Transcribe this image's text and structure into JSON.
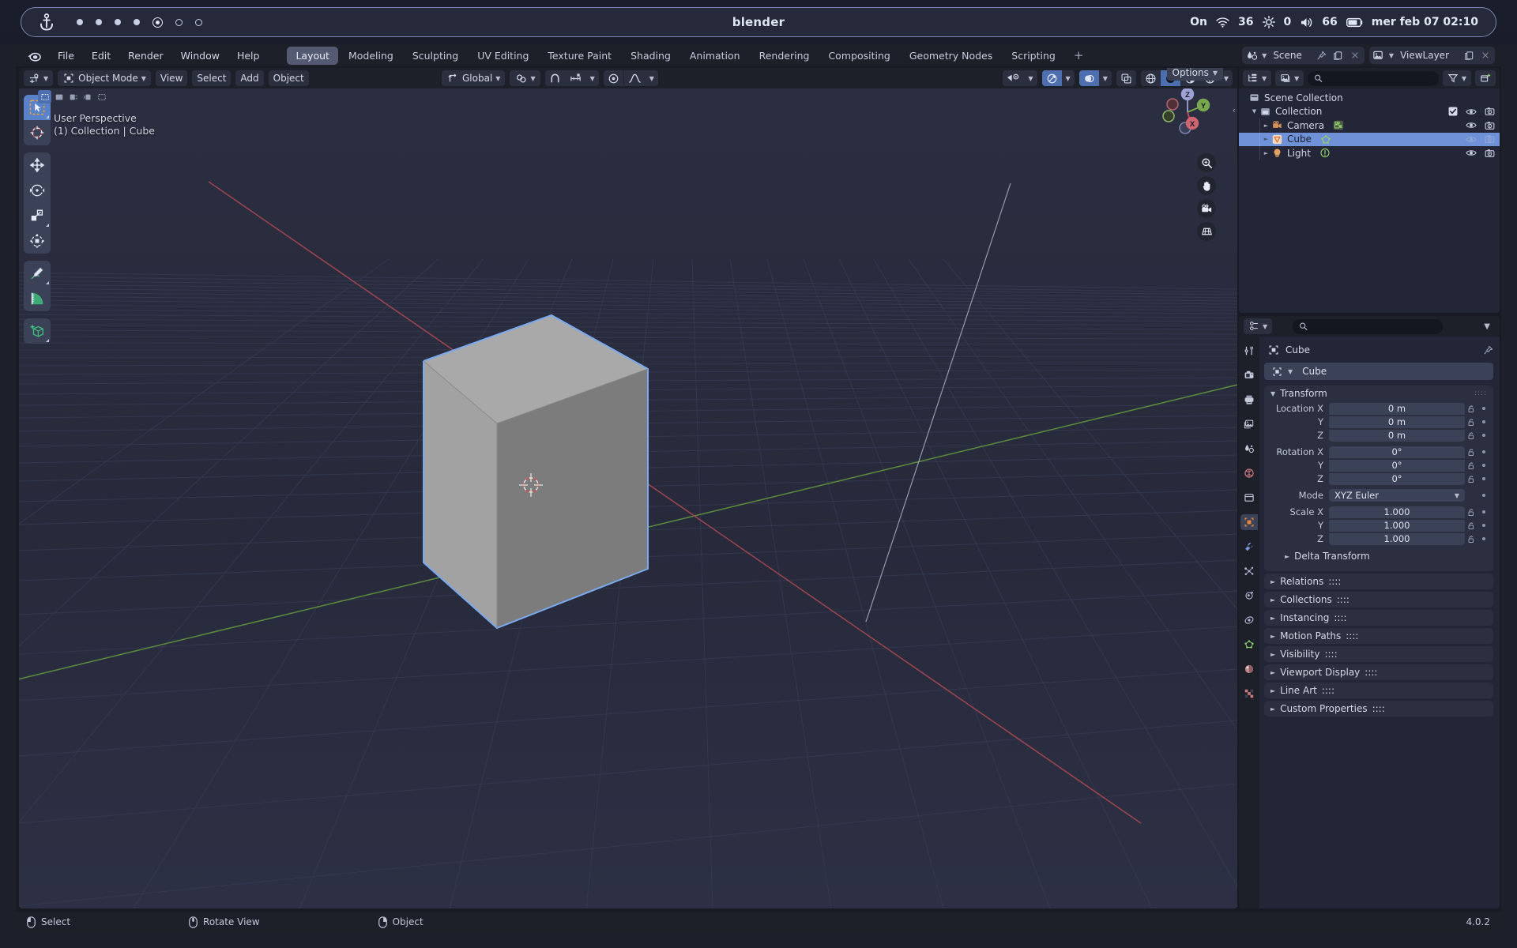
{
  "os_bar": {
    "title": "blender",
    "anchor_icon": "anchor-icon",
    "status": {
      "network_label": "On",
      "wifi_icon": "wifi-icon",
      "brightness_value": "36",
      "brightness_icon": "brightness-icon",
      "volume_value": "0",
      "volume_icon": "volume-icon",
      "battery_value": "66",
      "battery_icon": "battery-icon",
      "datetime": "mer feb 07 02:10"
    }
  },
  "topbar": {
    "logo_icon": "blender-logo-icon",
    "menus": [
      "File",
      "Edit",
      "Render",
      "Window",
      "Help"
    ],
    "workspaces": [
      {
        "label": "Layout",
        "active": true
      },
      {
        "label": "Modeling",
        "active": false
      },
      {
        "label": "Sculpting",
        "active": false
      },
      {
        "label": "UV Editing",
        "active": false
      },
      {
        "label": "Texture Paint",
        "active": false
      },
      {
        "label": "Shading",
        "active": false
      },
      {
        "label": "Animation",
        "active": false
      },
      {
        "label": "Rendering",
        "active": false
      },
      {
        "label": "Compositing",
        "active": false
      },
      {
        "label": "Geometry Nodes",
        "active": false
      },
      {
        "label": "Scripting",
        "active": false
      }
    ],
    "add_workspace_label": "+",
    "scene_name": "Scene",
    "viewlayer_name": "ViewLayer"
  },
  "viewport": {
    "header": {
      "editor_type_icon": "editor-type-3dviewport-icon",
      "mode_label": "Object Mode",
      "mode_icon": "object-mode-icon",
      "menus": [
        "View",
        "Select",
        "Add",
        "Object"
      ],
      "transform_orientation": "Global",
      "snap_icon": "magnet-icon",
      "proportional_icon": "proportional-editing-icon",
      "falloff_icon": "falloff-curve-icon",
      "pivot_icon": "pivot-point-icon"
    },
    "select_modes": [
      "tweak",
      "box-select",
      "circle-select",
      "lasso-select",
      "select-all"
    ],
    "overlay_text_line1": "User Perspective",
    "overlay_text_line2": "(1) Collection | Cube",
    "options_label": "Options",
    "gizmo_axes": [
      "Z",
      "Y",
      "X"
    ],
    "tools": [
      {
        "name": "tweak-tool",
        "active": true
      },
      {
        "name": "cursor-tool",
        "active": false
      },
      {
        "name": "move-tool",
        "active": false
      },
      {
        "name": "rotate-tool",
        "active": false
      },
      {
        "name": "scale-tool",
        "active": false
      },
      {
        "name": "transform-tool",
        "active": false
      },
      {
        "name": "annotate-tool",
        "active": false
      },
      {
        "name": "measure-tool",
        "active": false
      },
      {
        "name": "add-cube-tool",
        "active": false
      }
    ],
    "nav_controls": [
      "zoom-icon",
      "pan-hand-icon",
      "camera-view-icon",
      "ortho-persp-icon"
    ],
    "shading_modes": [
      "wireframe",
      "solid",
      "material-preview",
      "rendered"
    ],
    "active_shading": "solid"
  },
  "outliner": {
    "display_mode_icon": "outliner-display-mode-icon",
    "filter_id_icon": "outliner-id-type-icon",
    "search_placeholder": "",
    "search_value": "",
    "filter_icon": "filter-funnel-icon",
    "new_collection_icon": "new-collection-icon",
    "rows": [
      {
        "label": "Scene Collection",
        "icon": "scene-collection-icon",
        "depth": 0,
        "expandable": false,
        "selected": false,
        "checkbox": false,
        "eye": false,
        "camera": false
      },
      {
        "label": "Collection",
        "icon": "collection-icon",
        "depth": 1,
        "expandable": true,
        "expanded": true,
        "selected": false,
        "checkbox": true,
        "eye": true,
        "camera": true
      },
      {
        "label": "Camera",
        "icon": "camera-object-icon",
        "data_icon": "camera-data-icon",
        "depth": 2,
        "expandable": true,
        "expanded": false,
        "selected": false,
        "checkbox": false,
        "eye": true,
        "camera": true
      },
      {
        "label": "Cube",
        "icon": "mesh-object-icon",
        "data_icon": "mesh-data-icon",
        "depth": 2,
        "expandable": true,
        "expanded": false,
        "selected": true,
        "checkbox": false,
        "eye": true,
        "camera": true
      },
      {
        "label": "Light",
        "icon": "light-object-icon",
        "data_icon": "light-data-icon",
        "depth": 2,
        "expandable": true,
        "expanded": false,
        "selected": false,
        "checkbox": false,
        "eye": true,
        "camera": true
      }
    ]
  },
  "properties": {
    "editor_icon": "properties-editor-icon",
    "search_placeholder": "",
    "search_value": "",
    "breadcrumb_object": "Cube",
    "breadcrumb_icon": "object-properties-icon",
    "pin_icon": "pin-icon",
    "object_name_field": "Cube",
    "tabs": [
      {
        "name": "tool-tab",
        "active": false
      },
      {
        "name": "render-tab",
        "active": false
      },
      {
        "name": "output-tab",
        "active": false
      },
      {
        "name": "view-layer-tab",
        "active": false
      },
      {
        "name": "scene-tab",
        "active": false
      },
      {
        "name": "world-tab",
        "active": false
      },
      {
        "name": "collection-tab",
        "active": false
      },
      {
        "name": "object-tab",
        "active": true
      },
      {
        "name": "modifiers-tab",
        "active": false
      },
      {
        "name": "particles-tab",
        "active": false
      },
      {
        "name": "physics-tab",
        "active": false
      },
      {
        "name": "constraints-tab",
        "active": false
      },
      {
        "name": "object-data-tab",
        "active": false
      },
      {
        "name": "material-tab",
        "active": false
      },
      {
        "name": "texture-tab",
        "active": false
      }
    ],
    "transform_panel": {
      "title": "Transform",
      "location_label": "Location X",
      "rotation_label": "Rotation X",
      "scale_label": "Scale X",
      "axis_y": "Y",
      "axis_z": "Z",
      "location": [
        "0 m",
        "0 m",
        "0 m"
      ],
      "rotation": [
        "0°",
        "0°",
        "0°"
      ],
      "mode_label": "Mode",
      "mode_value": "XYZ Euler",
      "scale": [
        "1.000",
        "1.000",
        "1.000"
      ]
    },
    "subpanel_delta": "Delta Transform",
    "panels": [
      "Relations",
      "Collections",
      "Instancing",
      "Motion Paths",
      "Visibility",
      "Viewport Display",
      "Line Art",
      "Custom Properties"
    ]
  },
  "statusbar": {
    "items": [
      {
        "label": "Select",
        "icon": "mouse-left-icon"
      },
      {
        "label": "Rotate View",
        "icon": "mouse-middle-icon"
      },
      {
        "label": "Object",
        "icon": "mouse-right-icon"
      }
    ],
    "version": "4.0.2"
  },
  "colors": {
    "accent_blue": "#4d6fb0",
    "selection_blue": "#6f91d8",
    "panel_bg": "#2b2f3f",
    "editor_bg": "#232637",
    "header_bg": "#1d1f29",
    "axis_x_red": "#c04a56",
    "axis_y_green": "#7aa84f",
    "axis_z_blue": "#5b7fd4",
    "cube_light": "#a8a8a8",
    "cube_dark": "#787878"
  }
}
